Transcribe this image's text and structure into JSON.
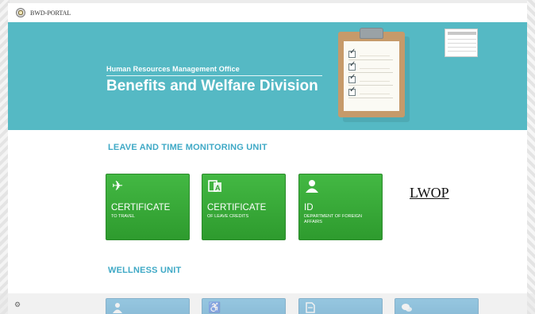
{
  "portal": {
    "name": "BWD-PORTAL",
    "seal_icon": "seal-icon"
  },
  "banner": {
    "office": "Human Resources Management Office",
    "division": "Benefits and Welfare Division",
    "bg_color": "#55b9c4",
    "illustration_icon": "clipboard-checklist-icon"
  },
  "leave_unit": {
    "title": "LEAVE AND TIME MONITORING UNIT",
    "tiles": [
      {
        "icon": "airplane-icon",
        "main": "CERTIFICATE",
        "sub": "TO TRAVEL"
      },
      {
        "icon": "translate-icon",
        "main": "CERTIFICATE",
        "sub": "OF LEAVE CREDITS"
      },
      {
        "icon": "user-icon",
        "main": "ID",
        "sub": "DEPARTMENT OF FOREIGN AFFAIRS"
      }
    ],
    "tile_color": "#3aac3a",
    "lwop_link": "LWOP"
  },
  "wellness_unit": {
    "title": "WELLNESS UNIT",
    "tiles": [
      {
        "icon": "user-icon"
      },
      {
        "icon": "wheelchair-icon"
      },
      {
        "icon": "document-icon"
      },
      {
        "icon": "chat-icon"
      }
    ],
    "tile_color": "#3a9fd4"
  }
}
